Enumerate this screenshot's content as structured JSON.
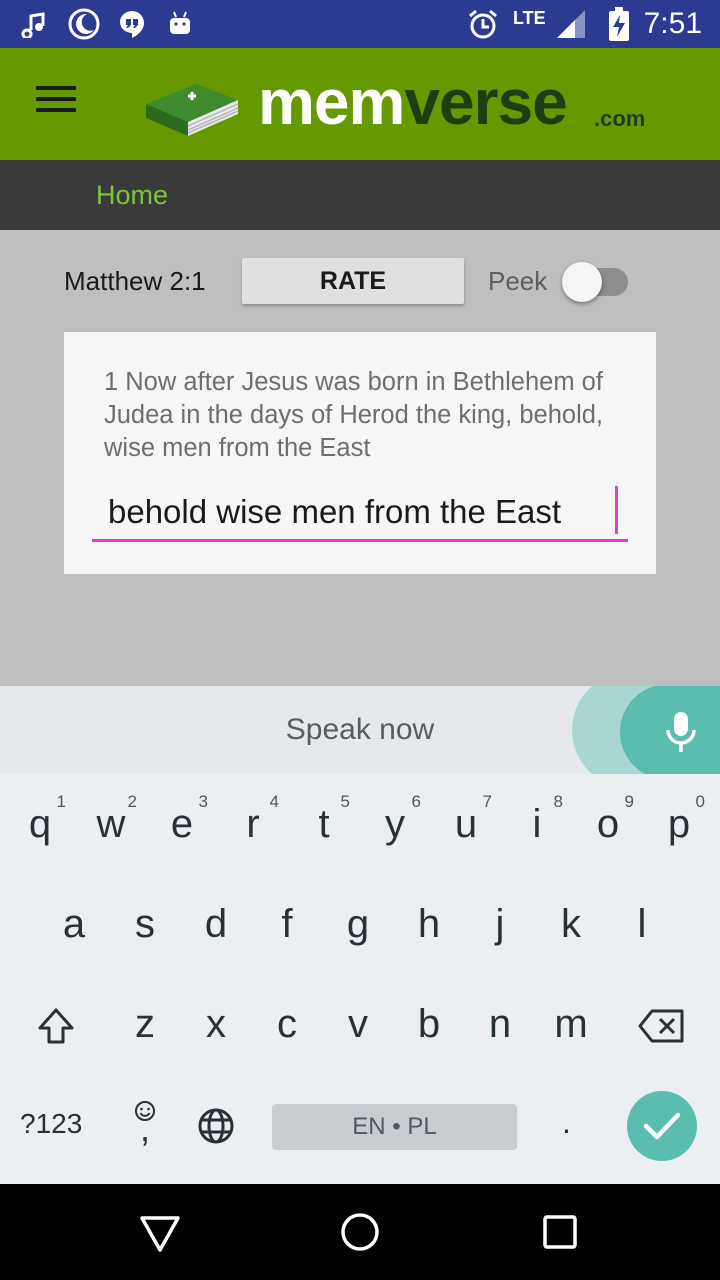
{
  "status_bar": {
    "network": "LTE",
    "time": "7:51",
    "icons": [
      "music-note-icon",
      "night-mode-icon",
      "hangouts-icon",
      "android-icon",
      "alarm-icon",
      "signal-icon",
      "battery-charging-icon"
    ]
  },
  "app_bar": {
    "menu_icon": "hamburger-menu-icon",
    "logo_mem": "mem",
    "logo_verse": "verse",
    "logo_com": ".com"
  },
  "nav": {
    "home_label": "Home"
  },
  "controls": {
    "verse_ref": "Matthew 2:1",
    "rate_label": "RATE",
    "peek_label": "Peek",
    "peek_on": false
  },
  "card": {
    "verse_text": "1 Now after Jesus was born in Bethlehem of Judea in the days of Herod the king, behold, wise men from the East",
    "answer_value": "behold wise men from the East"
  },
  "keyboard": {
    "speak_now": "Speak now",
    "row1": [
      {
        "ch": "q",
        "hint": "1"
      },
      {
        "ch": "w",
        "hint": "2"
      },
      {
        "ch": "e",
        "hint": "3"
      },
      {
        "ch": "r",
        "hint": "4"
      },
      {
        "ch": "t",
        "hint": "5"
      },
      {
        "ch": "y",
        "hint": "6"
      },
      {
        "ch": "u",
        "hint": "7"
      },
      {
        "ch": "i",
        "hint": "8"
      },
      {
        "ch": "o",
        "hint": "9"
      },
      {
        "ch": "p",
        "hint": "0"
      }
    ],
    "row2": [
      "a",
      "s",
      "d",
      "f",
      "g",
      "h",
      "j",
      "k",
      "l"
    ],
    "row3": [
      "z",
      "x",
      "c",
      "v",
      "b",
      "n",
      "m"
    ],
    "symbols_label": "?123",
    "comma_label": ",",
    "space_label": "EN • PL",
    "period_label": ".",
    "accent_color": "#5bbcb0"
  },
  "colors": {
    "status_bar": "#2d3a91",
    "app_bar": "#669900",
    "nav_bar": "#3a3a3a",
    "home_link": "#7fc23c",
    "input_underline": "#e040d0"
  }
}
